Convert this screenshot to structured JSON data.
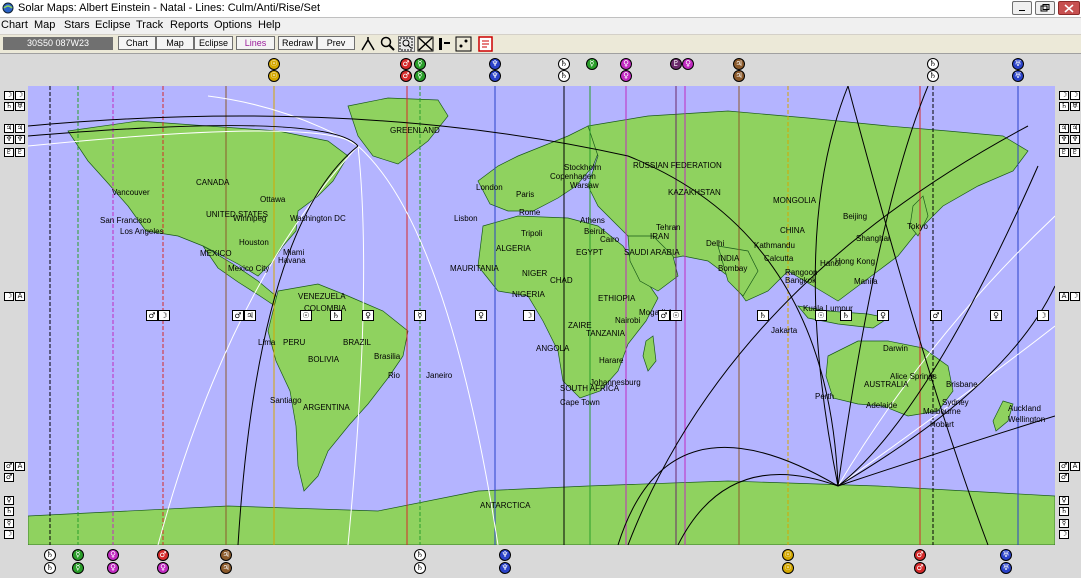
{
  "window": {
    "title": "Solar Maps: Albert Einstein - Natal - Lines: Culm/Anti/Rise/Set"
  },
  "menu": [
    "Chart",
    "Map",
    "Stars",
    "Eclipse",
    "Track",
    "Reports",
    "Options",
    "Help"
  ],
  "toolbar": {
    "coordinates": "30S50  087W23",
    "buttons": [
      {
        "label": "Chart",
        "active": false
      },
      {
        "label": "Map",
        "active": false
      },
      {
        "label": "Eclipse",
        "active": false
      },
      {
        "label": "Lines",
        "active": true
      },
      {
        "label": "Redraw",
        "active": false
      },
      {
        "label": "Prev",
        "active": false
      }
    ],
    "tools": [
      "line-tool-icon",
      "zoom-icon",
      "zoom-region-icon",
      "cross-icon",
      "bar-tool-icon",
      "star-tool-icon",
      "report-icon"
    ]
  },
  "map": {
    "countries": [
      "GREENLAND",
      "CANADA",
      "UNITED STATES",
      "MEXICO",
      "VENEZUELA",
      "COLOMBIA",
      "PERU",
      "BRAZIL",
      "BOLIVIA",
      "ARGENTINA",
      "RUSSIAN FEDERATION",
      "KAZAKHSTAN",
      "MONGOLIA",
      "CHINA",
      "INDIA",
      "IRAN",
      "SAUDI ARABIA",
      "EGYPT",
      "ALGERIA",
      "MAURITANIA",
      "NIGER",
      "CHAD",
      "NIGERIA",
      "ETHIOPIA",
      "ZAIRE",
      "TANZANIA",
      "ANGOLA",
      "SOUTH AFRICA",
      "AUSTRALIA",
      "ANTARCTICA"
    ],
    "cities": [
      "Vancouver",
      "Winnipeg",
      "Ottawa",
      "San Francisco",
      "Los Angeles",
      "Washington DC",
      "Houston",
      "Miami",
      "Havana",
      "Mexico City",
      "Lima",
      "Santiago",
      "Rio",
      "Janeiro",
      "Brasilia",
      "London",
      "Paris",
      "Stockholm",
      "Copenhagen",
      "Warsaw",
      "Rome",
      "Lisbon",
      "Athens",
      "Beirut",
      "Cairo",
      "Tehran",
      "Delhi",
      "Bombay",
      "Kathmandu",
      "Calcutta",
      "Rangoon",
      "Bangkok",
      "Hanoi",
      "Hong Kong",
      "Beijing",
      "Shanghai",
      "Tokyo",
      "Manila",
      "Kuala Lumpur",
      "Jakarta",
      "Darwin",
      "Alice Springs",
      "Brisbane",
      "Perth",
      "Adelaide",
      "Sydney",
      "Melbourne",
      "Hobart",
      "Auckland",
      "Wellington",
      "Nairobi",
      "Mogadishu",
      "Harare",
      "Johannesburg",
      "Cape Town",
      "Tripoli"
    ],
    "colors": {
      "ocean": "#b4b4ff",
      "land": "#8fd25f",
      "border": "#1a5a1a",
      "sun": "#d4a800",
      "moon": "#ffffff",
      "mercury": "#2a9e2a",
      "venus": "#c02ac0",
      "mars": "#d42a2a",
      "jupiter": "#8b5a2b",
      "saturn": "#303030",
      "uranus": "#2a42c8",
      "neptune": "#2a42c8",
      "pluto": "#6a2a6a"
    }
  },
  "glyphs": {
    "top": [
      "Sun",
      "Mars",
      "Mercury",
      "Neptune",
      "Saturn",
      "Mercury",
      "Venus",
      "Pluto",
      "Jupiter",
      "Saturn",
      "Uranus"
    ],
    "bottom": [
      "Saturn",
      "Mercury",
      "Venus",
      "Mars",
      "Jupiter",
      "Neptune",
      "Sun",
      "Mars",
      "Uranus"
    ],
    "left": [
      "Moon",
      "Moon",
      "Saturn",
      "Uranus",
      "Jupiter",
      "Moon",
      "Mars",
      "Mars",
      "Neptune",
      "Venus",
      "Saturn"
    ],
    "right": [
      "Moon",
      "Moon",
      "Saturn",
      "Uranus",
      "Jupiter",
      "Moon",
      "Mars",
      "Mars",
      "Neptune",
      "Venus",
      "Saturn"
    ]
  }
}
